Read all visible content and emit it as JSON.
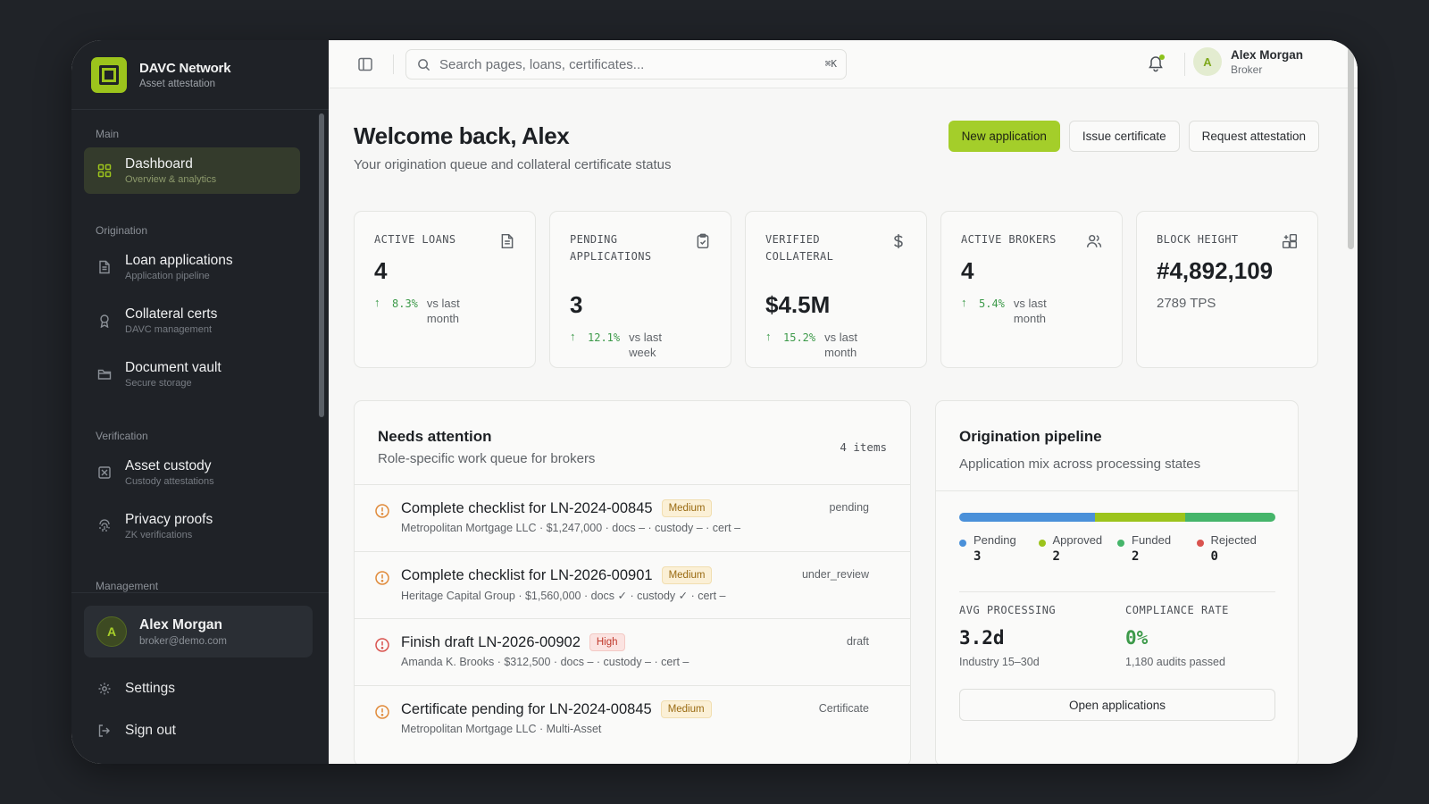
{
  "brand": {
    "name": "DAVC Network",
    "subtitle": "Asset attestation"
  },
  "sidebar": {
    "sections": [
      {
        "label": "Main"
      },
      {
        "label": "Origination"
      },
      {
        "label": "Verification"
      },
      {
        "label": "Management"
      }
    ],
    "items": [
      {
        "title": "Dashboard",
        "desc": "Overview & analytics",
        "icon": "grid-icon",
        "active": true
      },
      {
        "title": "Loan applications",
        "desc": "Application pipeline",
        "icon": "document-icon"
      },
      {
        "title": "Collateral certs",
        "desc": "DAVC management",
        "icon": "award-icon"
      },
      {
        "title": "Document vault",
        "desc": "Secure storage",
        "icon": "folder-icon"
      },
      {
        "title": "Asset custody",
        "desc": "Custody attestations",
        "icon": "custody-icon"
      },
      {
        "title": "Privacy proofs",
        "desc": "ZK verifications",
        "icon": "fingerprint-icon"
      }
    ],
    "user": {
      "initial": "A",
      "name": "Alex Morgan",
      "email": "broker@demo.com"
    },
    "settings_label": "Settings",
    "signout_label": "Sign out"
  },
  "topbar": {
    "search_placeholder": "Search pages, loans, certificates...",
    "shortcut": "⌘K",
    "user": {
      "initial": "A",
      "name": "Alex Morgan",
      "role": "Broker"
    }
  },
  "header": {
    "title": "Welcome back, Alex",
    "subtitle": "Your origination queue and collateral certificate status",
    "actions": {
      "new": "New application",
      "issue": "Issue certificate",
      "request": "Request attestation"
    }
  },
  "stats": [
    {
      "label": "Active loans",
      "value": "4",
      "trend": "8.3%",
      "compare": "vs last month",
      "icon": "document-icon"
    },
    {
      "label": "Pending applications",
      "value": "3",
      "trend": "12.1%",
      "compare": "vs last week",
      "icon": "clipboard-icon"
    },
    {
      "label": "Verified collateral",
      "value": "$4.5M",
      "trend": "15.2%",
      "compare": "vs last month",
      "icon": "dollar-icon"
    },
    {
      "label": "Active brokers",
      "value": "4",
      "trend": "5.4%",
      "compare": "vs last month",
      "icon": "users-icon"
    },
    {
      "label": "Block height",
      "value": "#4,892,109",
      "sub": "2789 TPS",
      "icon": "blocks-icon"
    }
  ],
  "attention": {
    "title": "Needs attention",
    "subtitle": "Role-specific work queue for brokers",
    "count": "4 items",
    "rows": [
      {
        "title": "Complete checklist for LN-2024-00845",
        "priority": "Medium",
        "meta": "Metropolitan Mortgage LLC · $1,247,000 · docs – · custody – · cert –",
        "status": "pending"
      },
      {
        "title": "Complete checklist for LN-2026-00901",
        "priority": "Medium",
        "meta": "Heritage Capital Group · $1,560,000 · docs ✓ · custody ✓ · cert –",
        "status": "under_review"
      },
      {
        "title": "Finish draft LN-2026-00902",
        "priority": "High",
        "meta": "Amanda K. Brooks · $312,500 · docs – · custody – · cert –",
        "status": "draft"
      },
      {
        "title": "Certificate pending for LN-2024-00845",
        "priority": "Medium",
        "meta": "Metropolitan Mortgage LLC · Multi-Asset",
        "status": "Certificate"
      }
    ]
  },
  "pipeline": {
    "title": "Origination pipeline",
    "subtitle": "Application mix across processing states",
    "states": [
      {
        "name": "Pending",
        "count": 3,
        "color": "#4a90d9"
      },
      {
        "name": "Approved",
        "count": 2,
        "color": "#9cc41c"
      },
      {
        "name": "Funded",
        "count": 2,
        "color": "#45b56a"
      },
      {
        "name": "Rejected",
        "count": 0,
        "color": "#d9534f"
      }
    ],
    "metrics": [
      {
        "label": "AVG PROCESSING",
        "value": "3.2d",
        "sub": "Industry 15–30d"
      },
      {
        "label": "COMPLIANCE RATE",
        "value": "0%",
        "sub": "1,180 audits passed"
      }
    ],
    "open_label": "Open applications"
  }
}
